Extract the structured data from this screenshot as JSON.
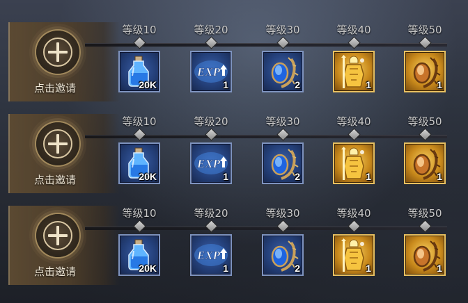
{
  "invite_label": "点击邀请",
  "levels": [
    "等级10",
    "等级20",
    "等级30",
    "等级40",
    "等级50"
  ],
  "rewards": [
    {
      "icon": "potion-bottle-icon",
      "count": "20K",
      "frame": "blue"
    },
    {
      "icon": "exp-boost-icon",
      "count": "1",
      "frame": "blue",
      "text": "EXP"
    },
    {
      "icon": "blue-gem-icon",
      "count": "2",
      "frame": "blue"
    },
    {
      "icon": "golden-knight-icon",
      "count": "1",
      "frame": "gold"
    },
    {
      "icon": "amber-gem-icon",
      "count": "1",
      "frame": "gold"
    }
  ],
  "rows": [
    {
      "id": "row-1"
    },
    {
      "id": "row-2"
    },
    {
      "id": "row-3"
    }
  ]
}
